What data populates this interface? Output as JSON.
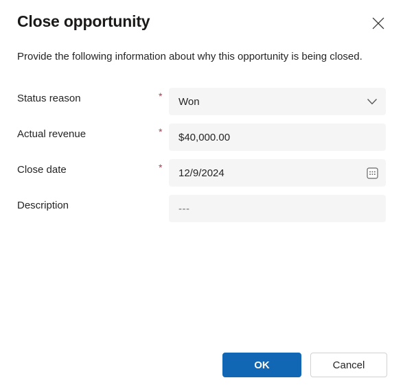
{
  "dialog": {
    "title": "Close opportunity",
    "subtitle": "Provide the following information about why this opportunity is being closed.",
    "close_icon": "close-icon"
  },
  "form": {
    "fields": [
      {
        "label": "Status reason",
        "required": true,
        "required_mark": "*",
        "value": "Won",
        "type": "select",
        "affordance_icon": "chevron-down-icon"
      },
      {
        "label": "Actual revenue",
        "required": true,
        "required_mark": "*",
        "value": "$40,000.00",
        "type": "text",
        "affordance_icon": ""
      },
      {
        "label": "Close date",
        "required": true,
        "required_mark": "*",
        "value": "12/9/2024",
        "type": "date",
        "affordance_icon": "calendar-icon"
      },
      {
        "label": "Description",
        "required": false,
        "required_mark": "",
        "value": "---",
        "is_placeholder": true,
        "type": "text",
        "affordance_icon": ""
      }
    ]
  },
  "footer": {
    "ok_label": "OK",
    "cancel_label": "Cancel"
  },
  "colors": {
    "primary_button": "#1267b4",
    "required_asterisk": "#c4314b",
    "field_background": "#f5f5f5",
    "text": "#242424",
    "placeholder_text": "#70706f",
    "dialog_background": "#ffffff"
  }
}
